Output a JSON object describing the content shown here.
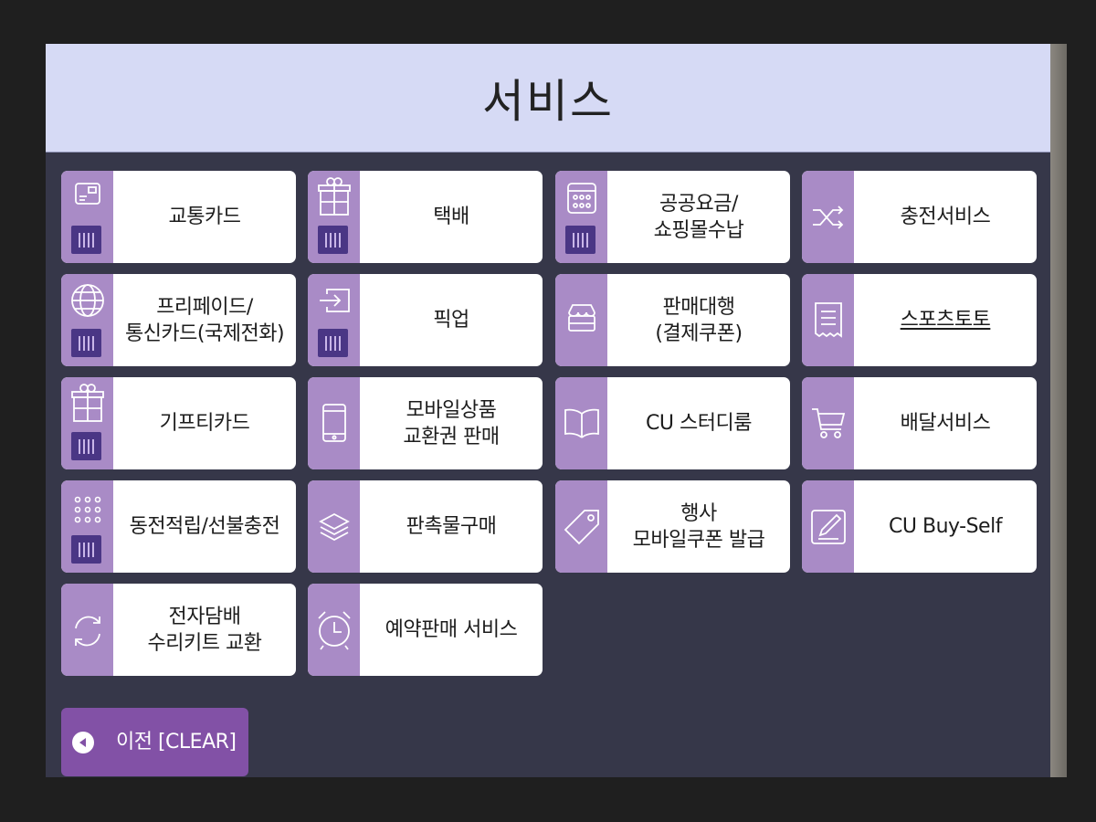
{
  "header": {
    "title": "서비스"
  },
  "tiles": [
    {
      "label": "교통카드",
      "icon": "transit-card-icon"
    },
    {
      "label": "택배",
      "icon": "gift-box-icon"
    },
    {
      "label": "공공요금/\n쇼핑몰수납",
      "icon": "calculator-icon"
    },
    {
      "label": "충전서비스",
      "icon": "shuffle-icon"
    },
    {
      "label": "프리페이드/\n통신카드(국제전화)",
      "icon": "globe-icon"
    },
    {
      "label": "픽업",
      "icon": "login-arrow-icon"
    },
    {
      "label": "판매대행\n(결제쿠폰)",
      "icon": "store-icon"
    },
    {
      "label": "스포츠토토",
      "icon": "receipt-icon"
    },
    {
      "label": "기프티카드",
      "icon": "gift-icon"
    },
    {
      "label": "모바일상품\n교환권 판매",
      "icon": "smartphone-icon"
    },
    {
      "label": "CU 스터디룸",
      "icon": "book-icon"
    },
    {
      "label": "배달서비스",
      "icon": "cart-icon"
    },
    {
      "label": "동전적립/선불충전",
      "icon": "coin-dots-icon"
    },
    {
      "label": "판촉물구매",
      "icon": "layers-icon"
    },
    {
      "label": "행사\n모바일쿠폰 발급",
      "icon": "tag-icon"
    },
    {
      "label": "CU Buy-Self",
      "icon": "edit-icon"
    },
    {
      "label": "전자담배\n수리키트 교환",
      "icon": "refresh-icon"
    },
    {
      "label": "예약판매 서비스",
      "icon": "alarm-clock-icon"
    }
  ],
  "back_button": {
    "label": "이전 [CLEAR]"
  },
  "colors": {
    "header_bg": "#d6daf5",
    "panel_bg": "#363749",
    "tile_strip": "#a98bc6",
    "card_badge": "#4a3685",
    "back_button": "#8251a6"
  }
}
